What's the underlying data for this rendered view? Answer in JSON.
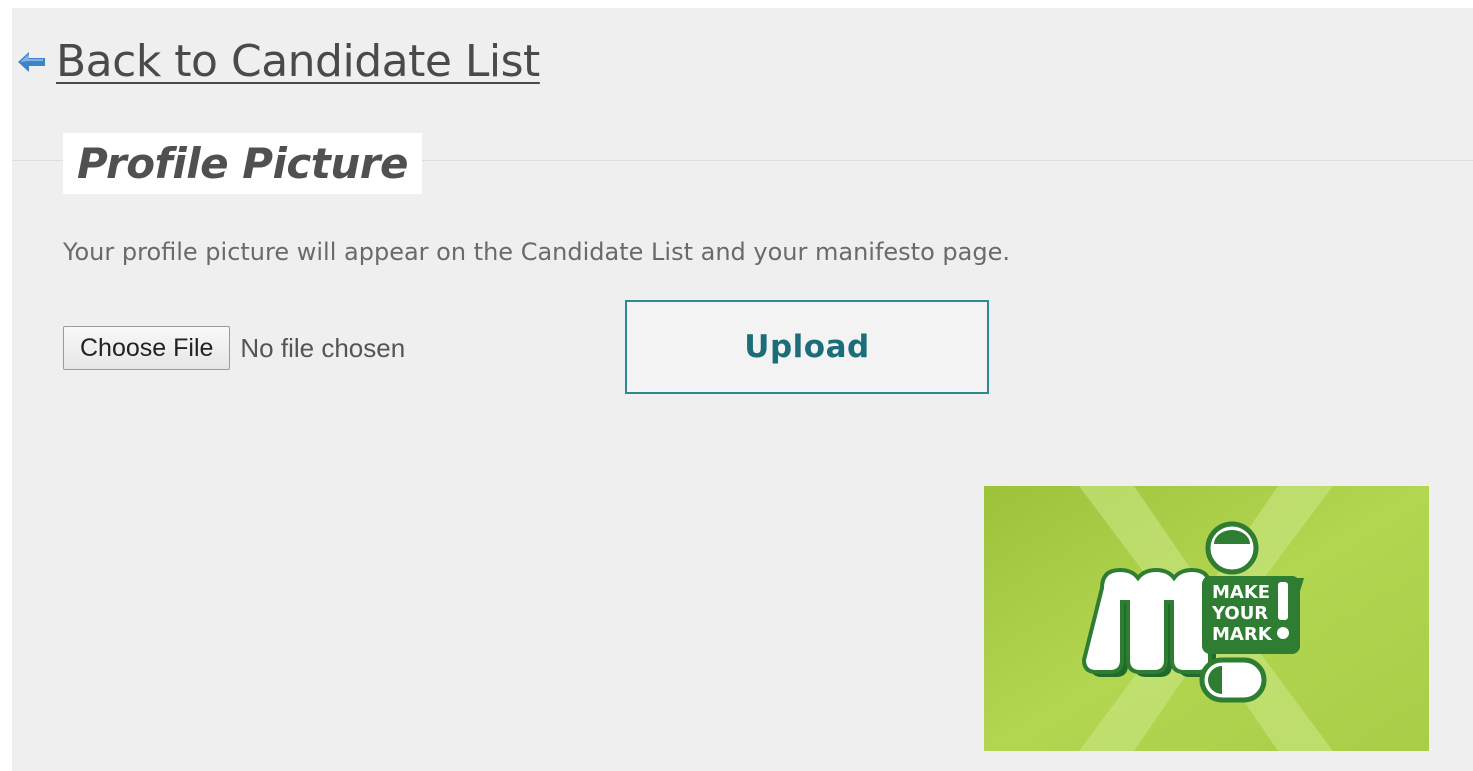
{
  "back_link": {
    "label": "Back to Candidate List",
    "icon": "back-arrow-icon"
  },
  "section": {
    "heading": "Profile Picture",
    "description": "Your profile picture will appear on the Candidate List and your manifesto page."
  },
  "file_input": {
    "button_label": "Choose File",
    "status": "No file chosen"
  },
  "upload": {
    "label": "Upload"
  },
  "profile_image": {
    "logo_text": "MAKE YOUR MARK!"
  },
  "colors": {
    "background": "#efefef",
    "heading_bg": "#ffffff",
    "upload_border": "#2f8a8f",
    "upload_text": "#1b6e79",
    "image_green": "#a4c639",
    "logo_dark_green": "#2e7d32"
  }
}
